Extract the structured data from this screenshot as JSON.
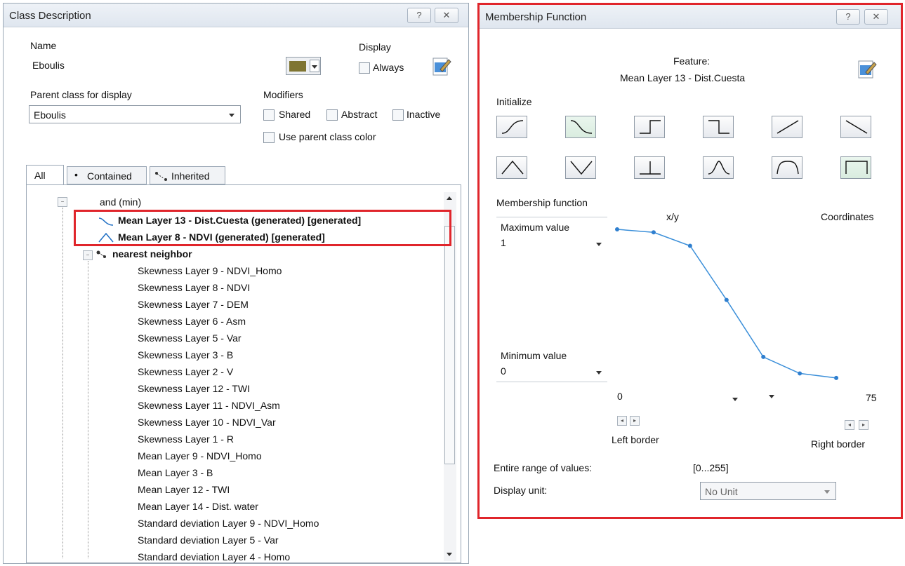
{
  "class_description": {
    "title": "Class Description",
    "help_btn": "?",
    "close_btn": "✕",
    "name_label": "Name",
    "name_value": "Eboulis",
    "display_label": "Display",
    "always_label": "Always",
    "class_color": "#7f7532",
    "parent_label": "Parent class for display",
    "parent_value": "Eboulis",
    "modifiers_label": "Modifiers",
    "shared_label": "Shared",
    "abstract_label": "Abstract",
    "inactive_label": "Inactive",
    "use_parent_color_label": "Use parent class color",
    "tabs": [
      "All",
      "Contained",
      "Inherited"
    ],
    "tree": {
      "root": "and (min)",
      "generated": [
        "Mean Layer 13 - Dist.Cuesta (generated) [generated]",
        "Mean Layer 8 - NDVI (generated) [generated]"
      ],
      "nn_label": "nearest neighbor",
      "features": [
        "Skewness Layer 9 - NDVI_Homo",
        "Skewness Layer 8 - NDVI",
        "Skewness Layer 7 - DEM",
        "Skewness Layer 6 - Asm",
        "Skewness Layer 5 - Var",
        "Skewness Layer 3 - B",
        "Skewness Layer 2 - V",
        "Skewness Layer 12 - TWI",
        "Skewness Layer 11 - NDVI_Asm",
        "Skewness Layer 10 - NDVI_Var",
        "Skewness Layer 1 - R",
        "Mean Layer 9 - NDVI_Homo",
        "Mean Layer 3 - B",
        "Mean Layer 12 - TWI",
        "Mean Layer 14 - Dist. water",
        "Standard deviation Layer 9 - NDVI_Homo",
        "Standard deviation Layer 5 - Var",
        "Standard deviation Layer 4 - Homo"
      ]
    }
  },
  "membership": {
    "title": "Membership Function",
    "help_btn": "?",
    "close_btn": "✕",
    "feature_label": "Feature:",
    "feature_value": "Mean Layer 13 - Dist.Cuesta",
    "initialize_label": "Initialize",
    "mf_label": "Membership function",
    "max_label": "Maximum value",
    "max_value": "1",
    "min_label": "Minimum value",
    "min_value": "0",
    "xy_label": "x/y",
    "coords_label": "Coordinates",
    "left_value": "0",
    "right_value": "75",
    "left_border": "Left border",
    "right_border": "Right border",
    "range_label": "Entire range of values:",
    "range_value": "[0...255]",
    "unit_label": "Display unit:",
    "unit_value": "No Unit",
    "curve": {
      "x_range": [
        0,
        75
      ],
      "y_range": [
        0,
        1
      ],
      "points": [
        [
          0,
          1.0
        ],
        [
          10.7,
          0.98
        ],
        [
          21.4,
          0.89
        ],
        [
          32.1,
          0.53
        ],
        [
          42.9,
          0.15
        ],
        [
          53.6,
          0.04
        ],
        [
          64.3,
          0.01
        ]
      ]
    }
  }
}
